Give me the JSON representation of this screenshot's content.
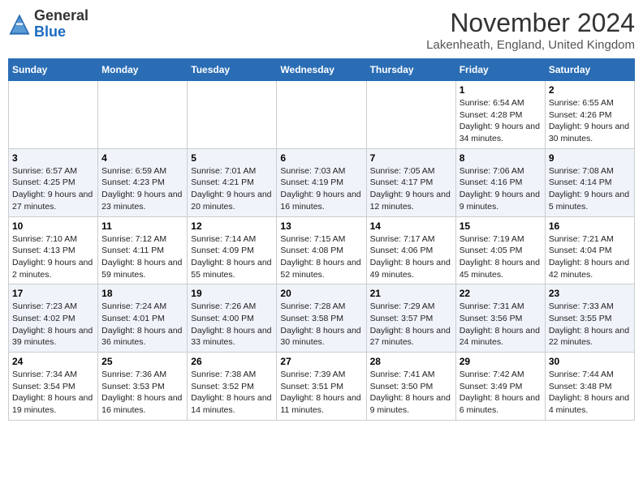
{
  "header": {
    "logo_general": "General",
    "logo_blue": "Blue",
    "month_title": "November 2024",
    "location": "Lakenheath, England, United Kingdom"
  },
  "days_of_week": [
    "Sunday",
    "Monday",
    "Tuesday",
    "Wednesday",
    "Thursday",
    "Friday",
    "Saturday"
  ],
  "weeks": [
    [
      {
        "day": "",
        "info": ""
      },
      {
        "day": "",
        "info": ""
      },
      {
        "day": "",
        "info": ""
      },
      {
        "day": "",
        "info": ""
      },
      {
        "day": "",
        "info": ""
      },
      {
        "day": "1",
        "info": "Sunrise: 6:54 AM\nSunset: 4:28 PM\nDaylight: 9 hours and 34 minutes."
      },
      {
        "day": "2",
        "info": "Sunrise: 6:55 AM\nSunset: 4:26 PM\nDaylight: 9 hours and 30 minutes."
      }
    ],
    [
      {
        "day": "3",
        "info": "Sunrise: 6:57 AM\nSunset: 4:25 PM\nDaylight: 9 hours and 27 minutes."
      },
      {
        "day": "4",
        "info": "Sunrise: 6:59 AM\nSunset: 4:23 PM\nDaylight: 9 hours and 23 minutes."
      },
      {
        "day": "5",
        "info": "Sunrise: 7:01 AM\nSunset: 4:21 PM\nDaylight: 9 hours and 20 minutes."
      },
      {
        "day": "6",
        "info": "Sunrise: 7:03 AM\nSunset: 4:19 PM\nDaylight: 9 hours and 16 minutes."
      },
      {
        "day": "7",
        "info": "Sunrise: 7:05 AM\nSunset: 4:17 PM\nDaylight: 9 hours and 12 minutes."
      },
      {
        "day": "8",
        "info": "Sunrise: 7:06 AM\nSunset: 4:16 PM\nDaylight: 9 hours and 9 minutes."
      },
      {
        "day": "9",
        "info": "Sunrise: 7:08 AM\nSunset: 4:14 PM\nDaylight: 9 hours and 5 minutes."
      }
    ],
    [
      {
        "day": "10",
        "info": "Sunrise: 7:10 AM\nSunset: 4:13 PM\nDaylight: 9 hours and 2 minutes."
      },
      {
        "day": "11",
        "info": "Sunrise: 7:12 AM\nSunset: 4:11 PM\nDaylight: 8 hours and 59 minutes."
      },
      {
        "day": "12",
        "info": "Sunrise: 7:14 AM\nSunset: 4:09 PM\nDaylight: 8 hours and 55 minutes."
      },
      {
        "day": "13",
        "info": "Sunrise: 7:15 AM\nSunset: 4:08 PM\nDaylight: 8 hours and 52 minutes."
      },
      {
        "day": "14",
        "info": "Sunrise: 7:17 AM\nSunset: 4:06 PM\nDaylight: 8 hours and 49 minutes."
      },
      {
        "day": "15",
        "info": "Sunrise: 7:19 AM\nSunset: 4:05 PM\nDaylight: 8 hours and 45 minutes."
      },
      {
        "day": "16",
        "info": "Sunrise: 7:21 AM\nSunset: 4:04 PM\nDaylight: 8 hours and 42 minutes."
      }
    ],
    [
      {
        "day": "17",
        "info": "Sunrise: 7:23 AM\nSunset: 4:02 PM\nDaylight: 8 hours and 39 minutes."
      },
      {
        "day": "18",
        "info": "Sunrise: 7:24 AM\nSunset: 4:01 PM\nDaylight: 8 hours and 36 minutes."
      },
      {
        "day": "19",
        "info": "Sunrise: 7:26 AM\nSunset: 4:00 PM\nDaylight: 8 hours and 33 minutes."
      },
      {
        "day": "20",
        "info": "Sunrise: 7:28 AM\nSunset: 3:58 PM\nDaylight: 8 hours and 30 minutes."
      },
      {
        "day": "21",
        "info": "Sunrise: 7:29 AM\nSunset: 3:57 PM\nDaylight: 8 hours and 27 minutes."
      },
      {
        "day": "22",
        "info": "Sunrise: 7:31 AM\nSunset: 3:56 PM\nDaylight: 8 hours and 24 minutes."
      },
      {
        "day": "23",
        "info": "Sunrise: 7:33 AM\nSunset: 3:55 PM\nDaylight: 8 hours and 22 minutes."
      }
    ],
    [
      {
        "day": "24",
        "info": "Sunrise: 7:34 AM\nSunset: 3:54 PM\nDaylight: 8 hours and 19 minutes."
      },
      {
        "day": "25",
        "info": "Sunrise: 7:36 AM\nSunset: 3:53 PM\nDaylight: 8 hours and 16 minutes."
      },
      {
        "day": "26",
        "info": "Sunrise: 7:38 AM\nSunset: 3:52 PM\nDaylight: 8 hours and 14 minutes."
      },
      {
        "day": "27",
        "info": "Sunrise: 7:39 AM\nSunset: 3:51 PM\nDaylight: 8 hours and 11 minutes."
      },
      {
        "day": "28",
        "info": "Sunrise: 7:41 AM\nSunset: 3:50 PM\nDaylight: 8 hours and 9 minutes."
      },
      {
        "day": "29",
        "info": "Sunrise: 7:42 AM\nSunset: 3:49 PM\nDaylight: 8 hours and 6 minutes."
      },
      {
        "day": "30",
        "info": "Sunrise: 7:44 AM\nSunset: 3:48 PM\nDaylight: 8 hours and 4 minutes."
      }
    ]
  ]
}
